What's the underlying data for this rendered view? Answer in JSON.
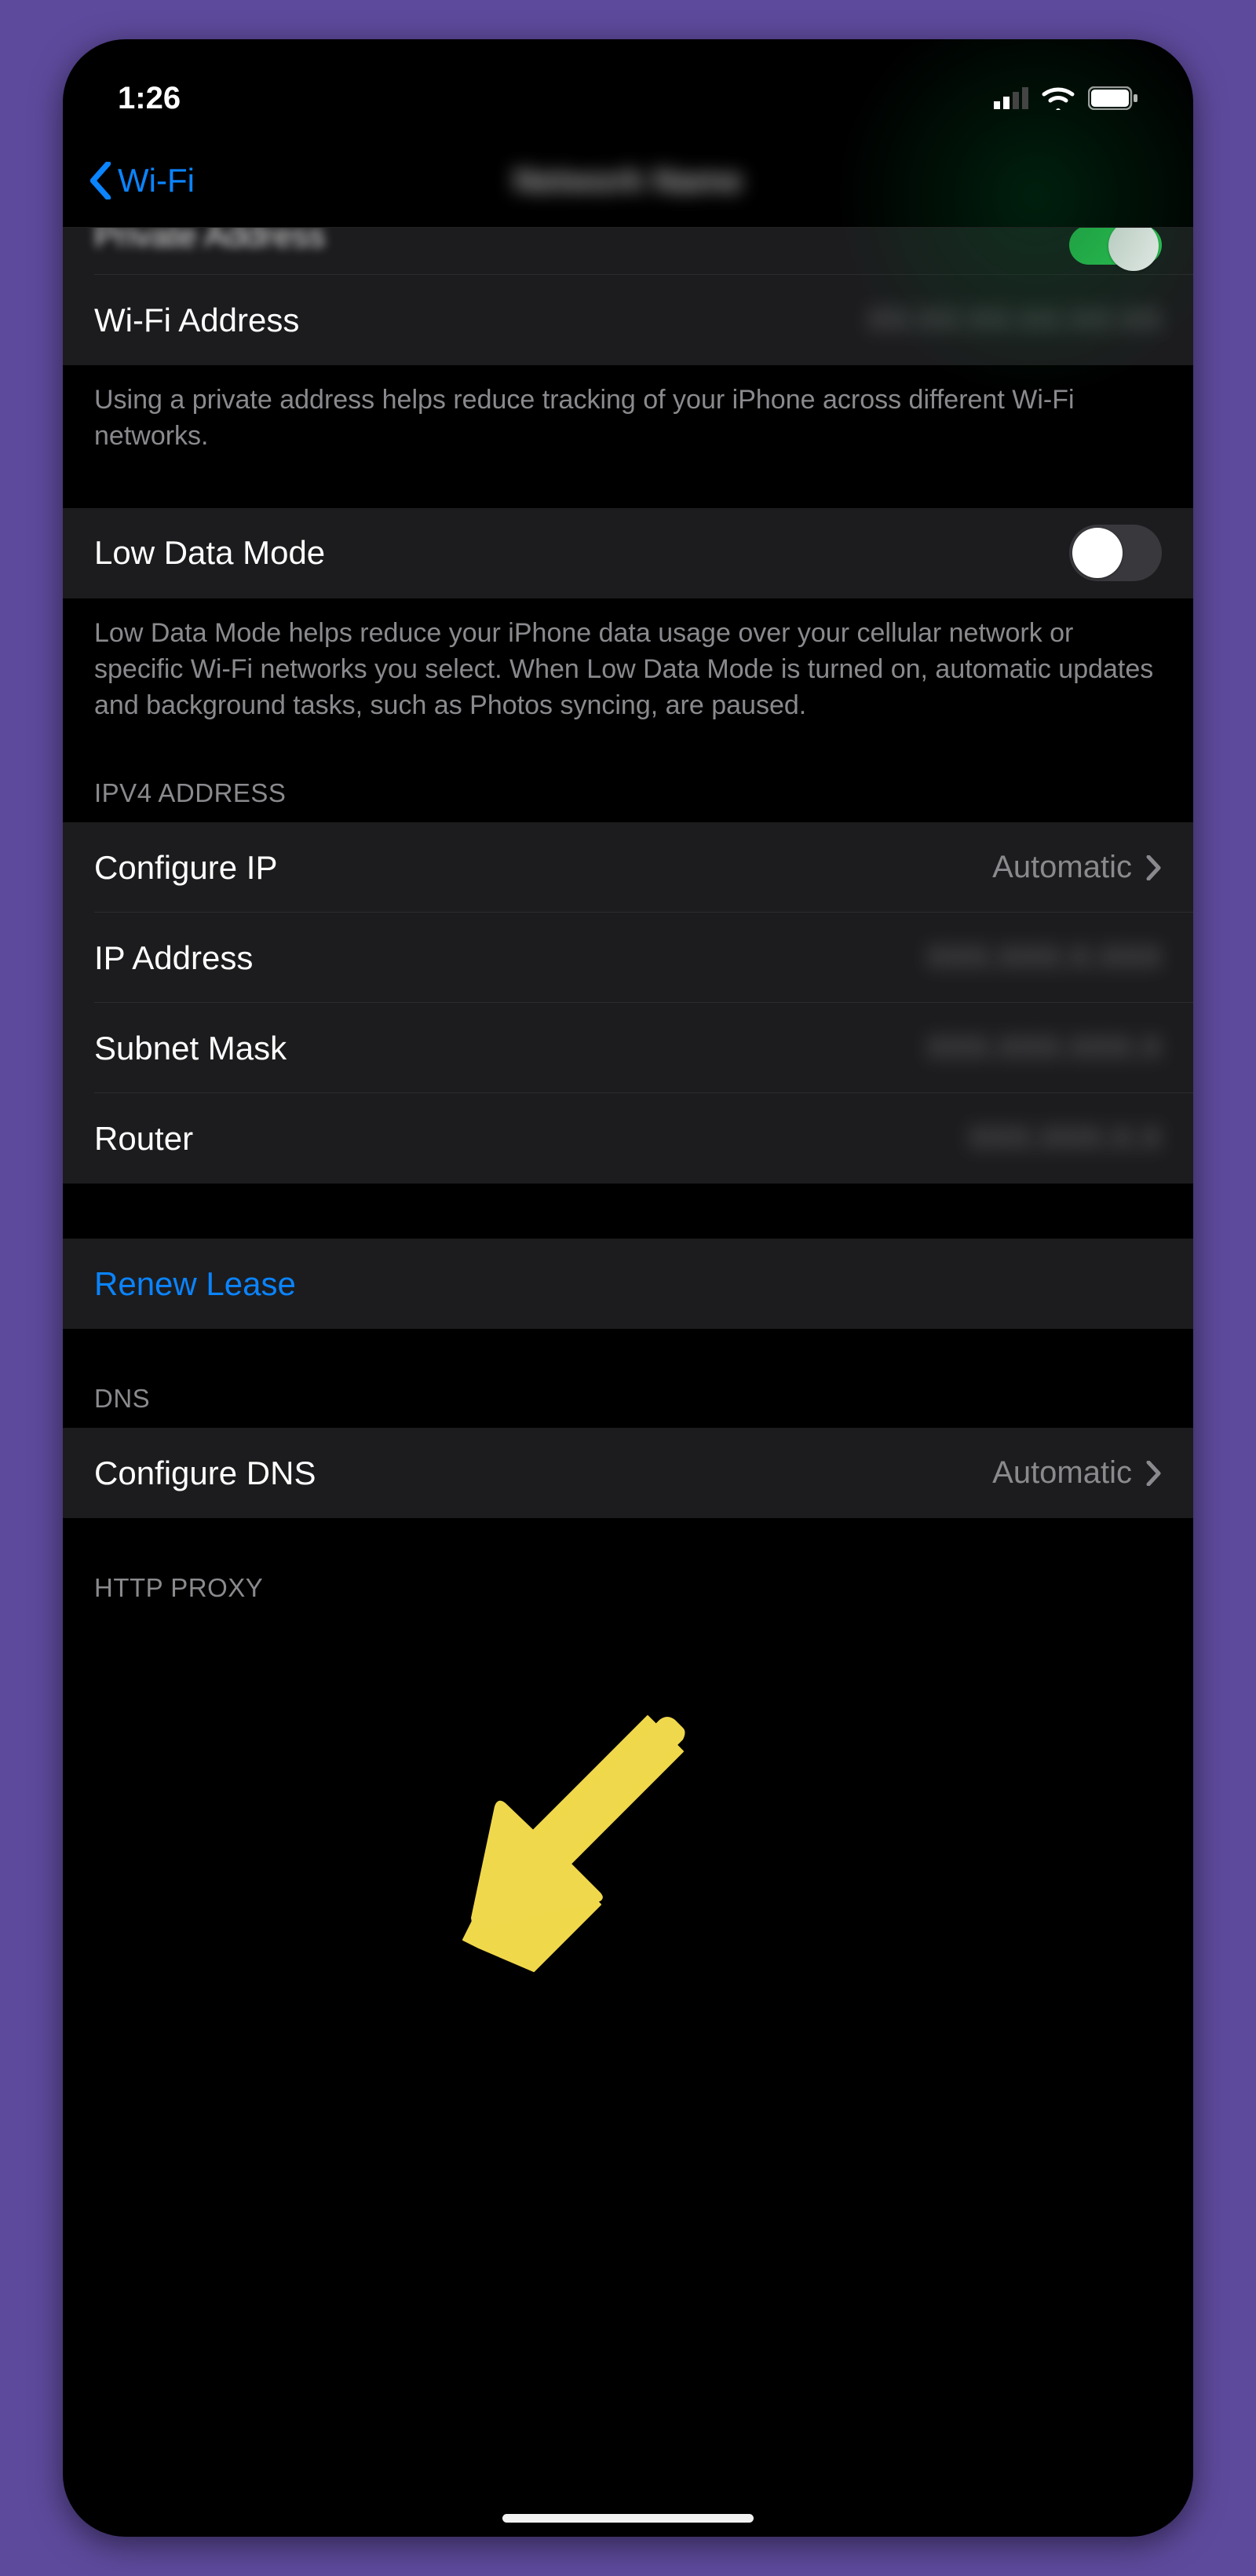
{
  "status": {
    "time": "1:26"
  },
  "nav": {
    "back_label": "Wi-Fi",
    "title": "Network Name"
  },
  "rows": {
    "private_address": {
      "label": "Private Address",
      "on": true,
      "truncated": true
    },
    "wifi_address": {
      "label": "Wi-Fi Address",
      "value": "XX:XX:XX:XX:XX:XX"
    },
    "private_footer": "Using a private address helps reduce tracking of your iPhone across different Wi-Fi networks.",
    "low_data_mode": {
      "label": "Low Data Mode",
      "on": false
    },
    "low_data_footer": "Low Data Mode helps reduce your iPhone data usage over your cellular network or specific Wi-Fi networks you select. When Low Data Mode is turned on, automatic updates and background tasks, such as Photos syncing, are paused.",
    "ipv4_header": "IPV4 ADDRESS",
    "configure_ip": {
      "label": "Configure IP",
      "value": "Automatic"
    },
    "ip_address": {
      "label": "IP Address",
      "value": "XXX.XXX.X.XXX"
    },
    "subnet_mask": {
      "label": "Subnet Mask",
      "value": "XXX.XXX.XXX.X"
    },
    "router": {
      "label": "Router",
      "value": "XXX.XXX.X.X"
    },
    "renew_lease": {
      "label": "Renew Lease"
    },
    "dns_header": "DNS",
    "configure_dns": {
      "label": "Configure DNS",
      "value": "Automatic"
    },
    "http_proxy_header": "HTTP PROXY"
  }
}
